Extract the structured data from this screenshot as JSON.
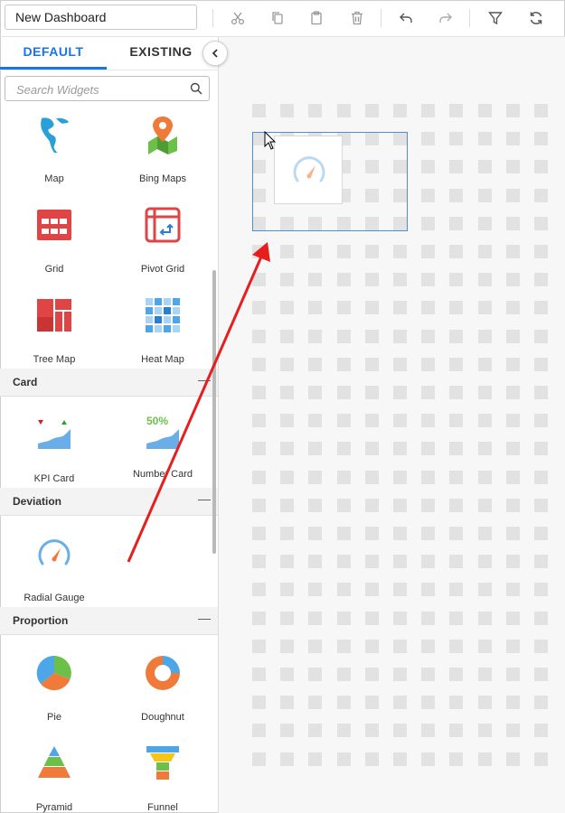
{
  "toolbar": {
    "dashboard_name": "New Dashboard",
    "buttons": [
      "cut-icon",
      "copy-icon",
      "paste-icon",
      "delete-icon",
      "undo-icon",
      "redo-icon",
      "filter-icon",
      "refresh-icon"
    ]
  },
  "sidebar": {
    "tabs": {
      "default": "DEFAULT",
      "existing": "EXISTING"
    },
    "search_placeholder": "Search Widgets",
    "widgets": {
      "map": "Map",
      "bing_maps": "Bing Maps",
      "grid": "Grid",
      "pivot_grid": "Pivot Grid",
      "tree_map": "Tree Map",
      "heat_map": "Heat Map",
      "kpi_card": "KPI Card",
      "number_card": "Number Card",
      "number_card_value": "50%",
      "radial_gauge": "Radial Gauge",
      "pie": "Pie",
      "doughnut": "Doughnut",
      "pyramid": "Pyramid",
      "funnel": "Funnel"
    },
    "groups": {
      "card": "Card",
      "deviation": "Deviation",
      "proportion": "Proportion",
      "collapse_symbol": "—"
    }
  },
  "colors": {
    "accent": "#1a73e8",
    "arrow": "#e61e1e",
    "icon_red": "#e04444",
    "icon_orange": "#f07a3a",
    "icon_blue": "#4da6e8",
    "icon_green": "#6cc04a"
  }
}
